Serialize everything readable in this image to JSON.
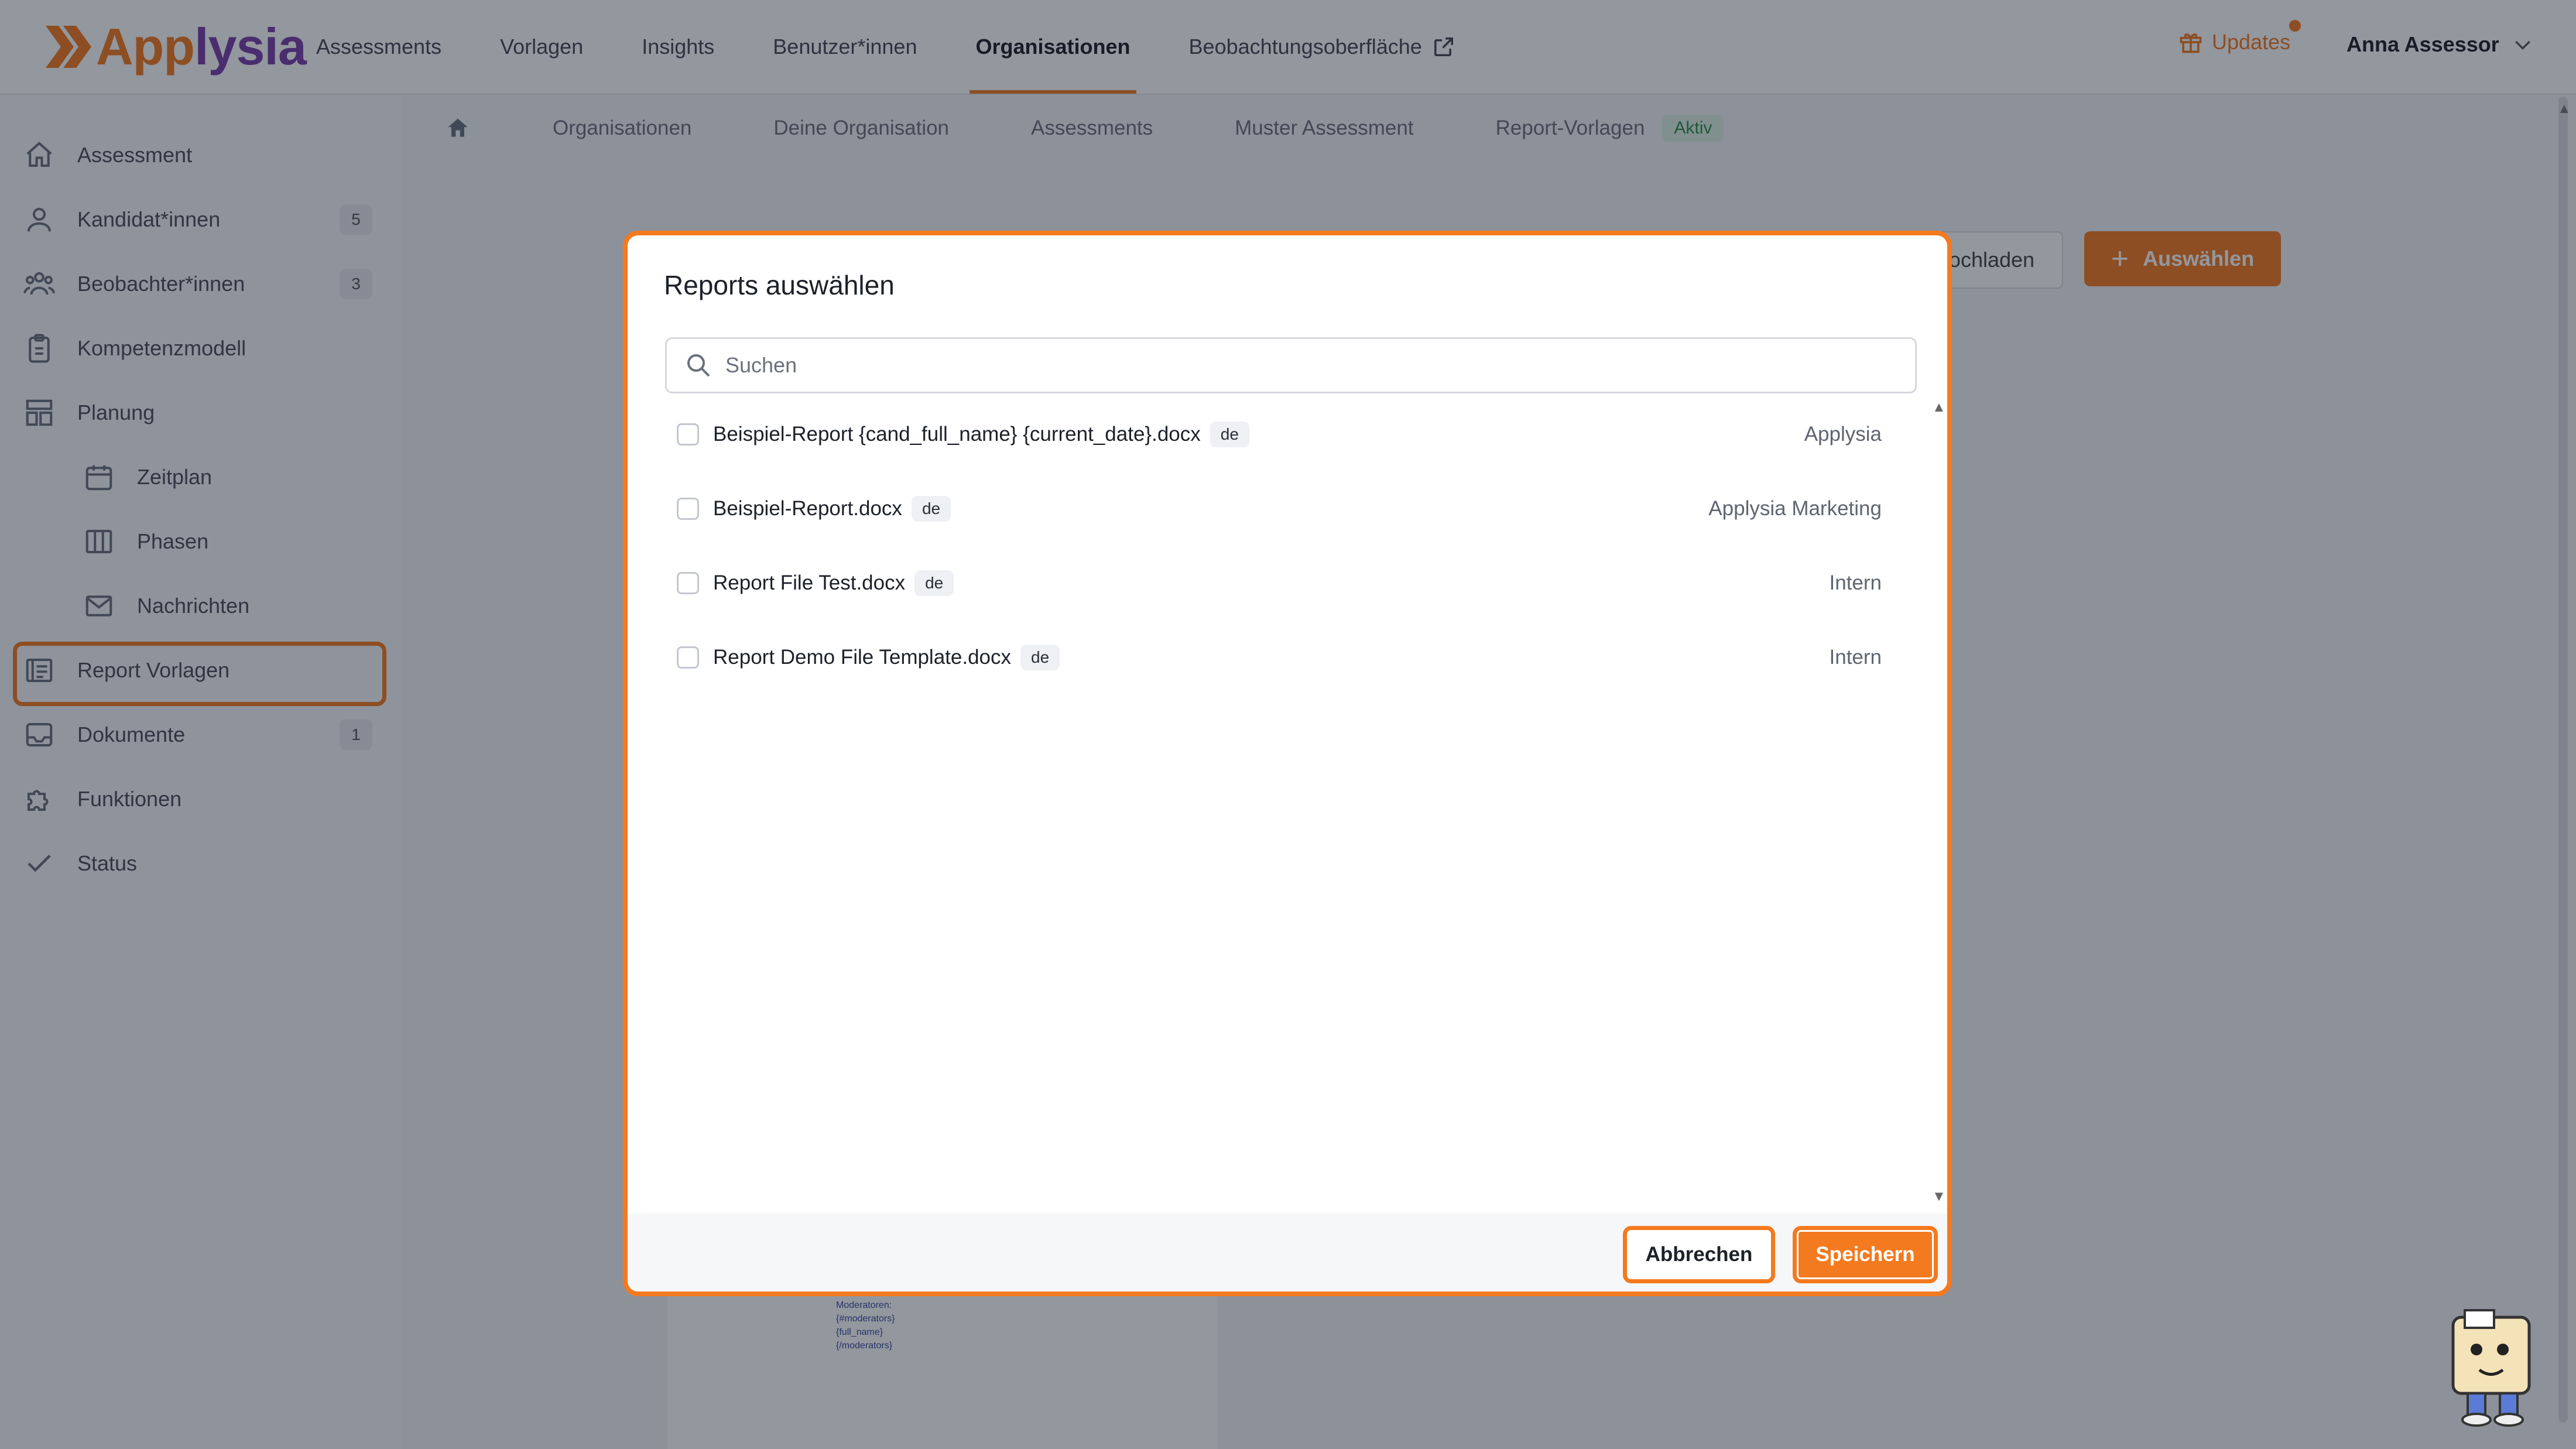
{
  "app": {
    "logo_text": "Applysia",
    "brand_color": "#f47a1f"
  },
  "nav": {
    "items": [
      {
        "label": "Assessments"
      },
      {
        "label": "Vorlagen"
      },
      {
        "label": "Insights"
      },
      {
        "label": "Benutzer*innen"
      },
      {
        "label": "Organisationen",
        "active": true
      },
      {
        "label": "Beobachtungsoberfläche",
        "icon": "external-link-icon"
      }
    ],
    "updates_label": "Updates",
    "user_name": "Anna Assessor"
  },
  "sidebar": {
    "items": [
      {
        "label": "Assessment",
        "icon": "home-icon"
      },
      {
        "label": "Kandidat*innen",
        "icon": "user-icon",
        "badge": "5"
      },
      {
        "label": "Beobachter*innen",
        "icon": "users-icon",
        "badge": "3"
      },
      {
        "label": "Kompetenzmodell",
        "icon": "clipboard-icon"
      },
      {
        "label": "Planung",
        "icon": "layout-icon"
      },
      {
        "label": "Zeitplan",
        "icon": "calendar-icon"
      },
      {
        "label": "Phasen",
        "icon": "columns-icon"
      },
      {
        "label": "Nachrichten",
        "icon": "mail-icon"
      },
      {
        "label": "Report Vorlagen",
        "icon": "report-icon",
        "highlighted": true
      },
      {
        "label": "Dokumente",
        "icon": "inbox-icon",
        "badge": "1"
      },
      {
        "label": "Funktionen",
        "icon": "puzzle-icon"
      },
      {
        "label": "Status",
        "icon": "check-icon"
      }
    ]
  },
  "breadcrumb": {
    "items": [
      "Organisationen",
      "Deine Organisation",
      "Assessments",
      "Muster Assessment",
      "Report-Vorlagen"
    ],
    "status": "Aktiv"
  },
  "background": {
    "upload_label": "ochladen",
    "select_label": "Auswählen",
    "card_text": "Moderatoren:\n{#moderators}\n{full_name}\n{/moderators}"
  },
  "modal": {
    "title": "Reports auswählen",
    "search_placeholder": "Suchen",
    "reports": [
      {
        "name": "Beispiel-Report {cand_full_name} {current_date}.docx",
        "lang": "de",
        "owner": "Applysia"
      },
      {
        "name": "Beispiel-Report.docx",
        "lang": "de",
        "owner": "Applysia Marketing"
      },
      {
        "name": "Report File Test.docx",
        "lang": "de",
        "owner": "Intern"
      },
      {
        "name": "Report Demo File Template.docx",
        "lang": "de",
        "owner": "Intern"
      }
    ],
    "cancel_label": "Abbrechen",
    "save_label": "Speichern"
  }
}
